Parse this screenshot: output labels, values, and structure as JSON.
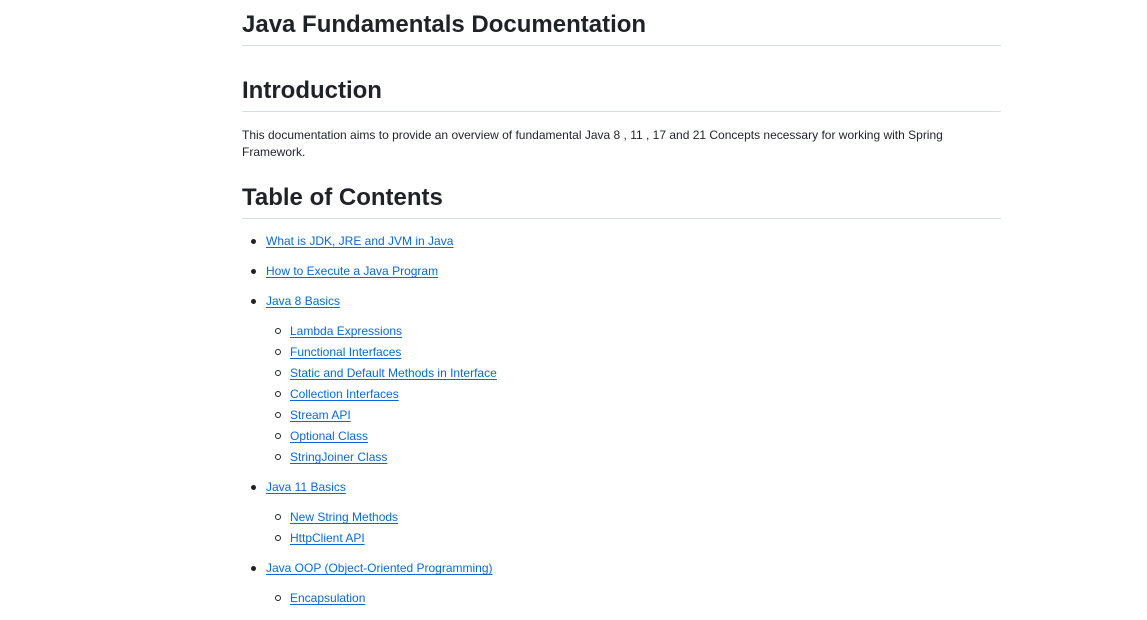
{
  "doc": {
    "title": "Java Fundamentals Documentation",
    "intro_heading": "Introduction",
    "intro_text": "This documentation aims to provide an overview of fundamental Java 8 , 11 , 17 and 21 Concepts necessary for working with Spring Framework.",
    "toc_heading": "Table of Contents"
  },
  "toc": [
    {
      "label": "What is JDK, JRE and JVM in Java",
      "children": []
    },
    {
      "label": "How to Execute a Java Program",
      "children": []
    },
    {
      "label": "Java 8 Basics",
      "children": [
        "Lambda Expressions",
        "Functional Interfaces",
        "Static and Default Methods in Interface",
        "Collection Interfaces",
        "Stream API",
        "Optional Class",
        "StringJoiner Class"
      ]
    },
    {
      "label": "Java 11 Basics",
      "children": [
        "New String Methods",
        "HttpClient API"
      ]
    },
    {
      "label": "Java OOP (Object-Oriented Programming)",
      "children": [
        "Encapsulation"
      ]
    }
  ],
  "colors": {
    "link": "#0969da",
    "text": "#1f2328",
    "rule": "#d8dee4"
  }
}
